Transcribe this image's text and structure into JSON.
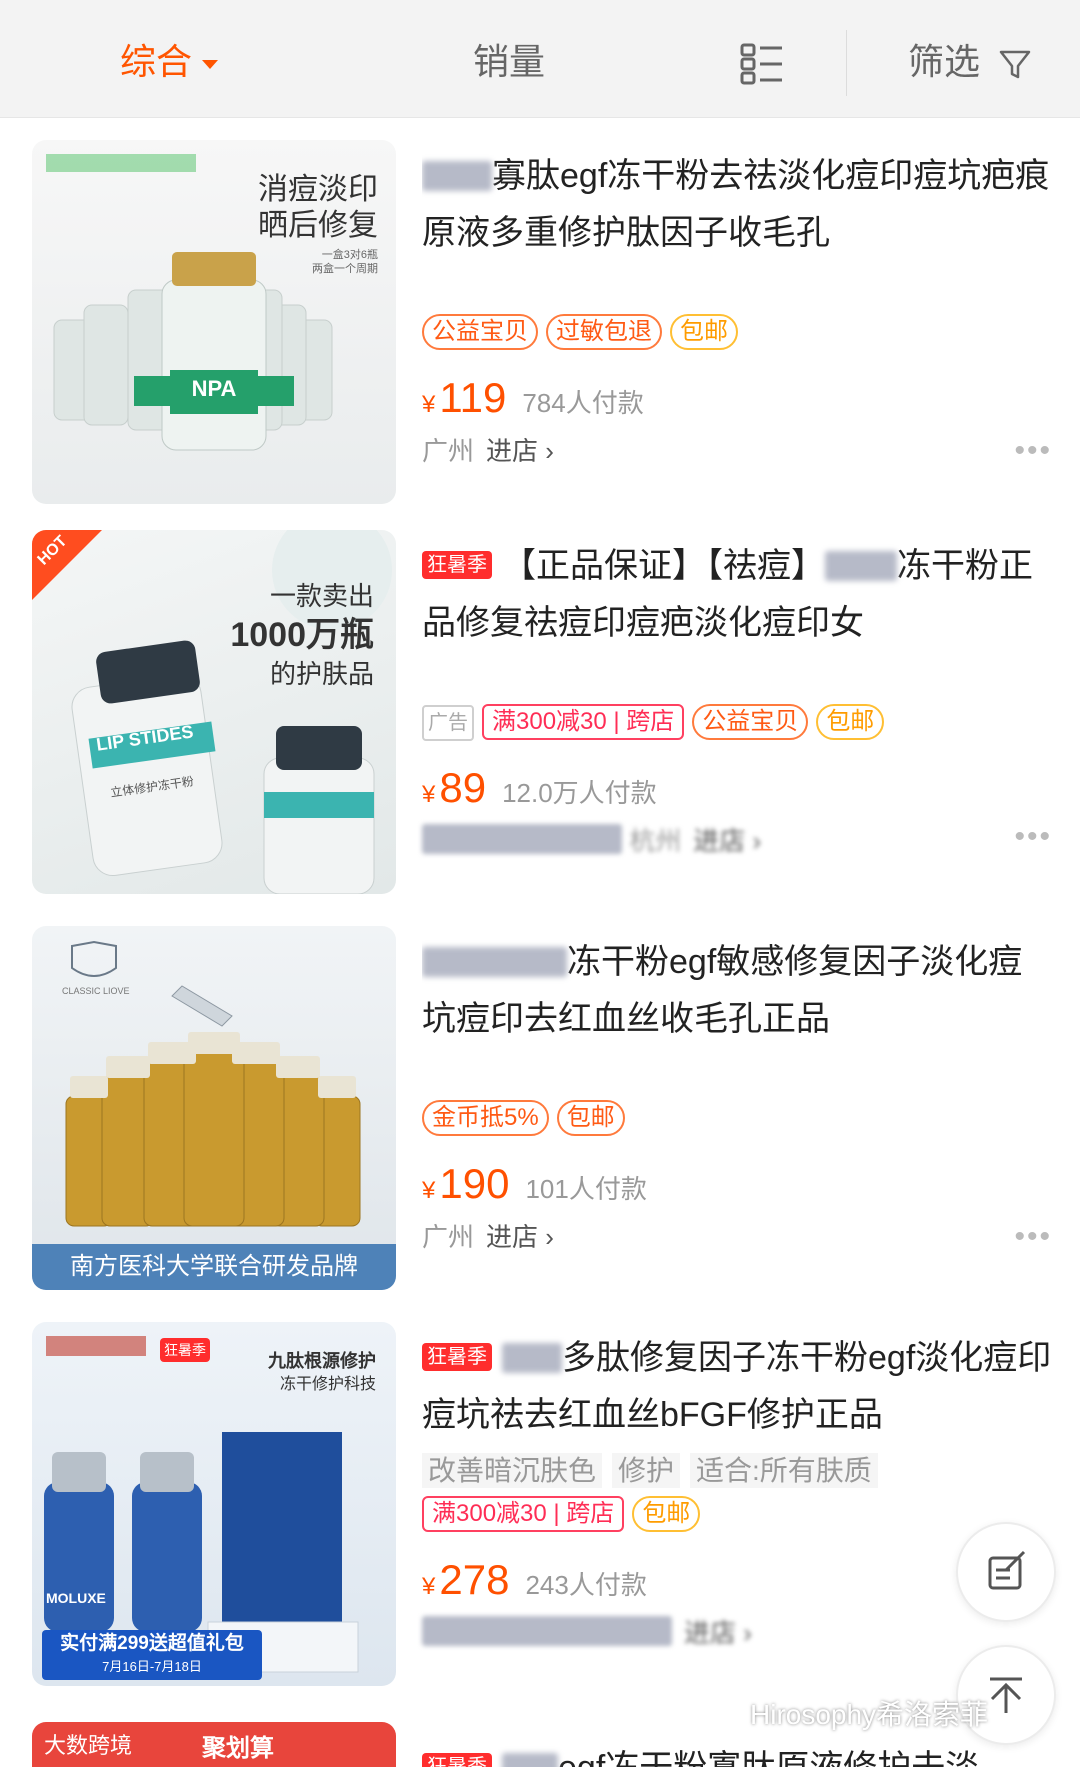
{
  "sortbar": {
    "zonghe": "综合",
    "xiaoliang": "销量",
    "filter": "筛选"
  },
  "products": [
    {
      "image_badge_small": "",
      "image_caption_1": "消痘淡印",
      "image_caption_2": "晒后修复",
      "image_caption_3": "一盒3对6瓶",
      "image_caption_4": "两盒一个周期",
      "image_label": "NPA",
      "title_prefix": "NPA",
      "title": "寡肽egf冻干粉去祛淡化痘印痘坑疤痕原液多重修护肽因子收毛孔",
      "badges": [
        "公益宝贝",
        "过敏包退",
        "包邮"
      ],
      "yen": "¥",
      "price": "119",
      "sales": "784人付款",
      "city": "广州",
      "enter": "进店 ›"
    },
    {
      "hot_tag": "狂暑季",
      "corner_badge": "HOT",
      "image_caption_1": "一款卖出",
      "image_caption_2": "1000万瓶",
      "image_caption_3": "的护肤品",
      "image_label": "LIP STIDES",
      "image_sub": "立体修护冻干粉",
      "title": "【正品保证】【祛痘】",
      "title_suffix": "冻干粉正品修复祛痘印痘疤淡化痘印女",
      "ad_tag": "广告",
      "badges": [
        "满300减30 | 跨店",
        "公益宝贝",
        "包邮"
      ],
      "yen": "¥",
      "price": "89",
      "sales": "12.0万人付款",
      "city": "杭州",
      "enter": "进店 ›"
    },
    {
      "image_banner": "南方医科大学联合研发品牌",
      "image_label": "CLASSIC LIOVE",
      "title": "冻干粉egf敏感修复因子淡化痘坑痘印去红血丝收毛孔正品",
      "badges": [
        "金币抵5%",
        "包邮"
      ],
      "yen": "¥",
      "price": "190",
      "sales": "101人付款",
      "city": "广州",
      "enter": "进店 ›"
    },
    {
      "hot_tag": "狂暑季",
      "image_caption_1": "九肽根源修护",
      "image_caption_2": "冻干修护科技",
      "image_mini_tag": "狂暑季",
      "image_banner": "实付满299送超值礼包",
      "image_banner_date": "7月16日-7月18日",
      "image_label": "MOLUXE",
      "title": "多肽修复因子冻干粉egf淡化痘印痘坑祛去红血丝bFGF修护正品",
      "attrs": [
        "改善暗沉肤色",
        "修护",
        "适合:所有肤质"
      ],
      "badges": [
        "满300减30 | 跨店",
        "包邮"
      ],
      "yen": "¥",
      "price": "278",
      "sales": "243人付款",
      "enter": "进店 ›"
    }
  ],
  "partial": {
    "image_left": "大数跨境",
    "image_right": "聚划算",
    "hot_tag": "狂暑季",
    "title": "egf冻干粉寡肽原液修护去淡"
  },
  "watermark": "Hirosophy希洛索菲",
  "colors": {
    "accent": "#ff5500",
    "price": "#ff5000",
    "hot": "#ff2d2d"
  }
}
